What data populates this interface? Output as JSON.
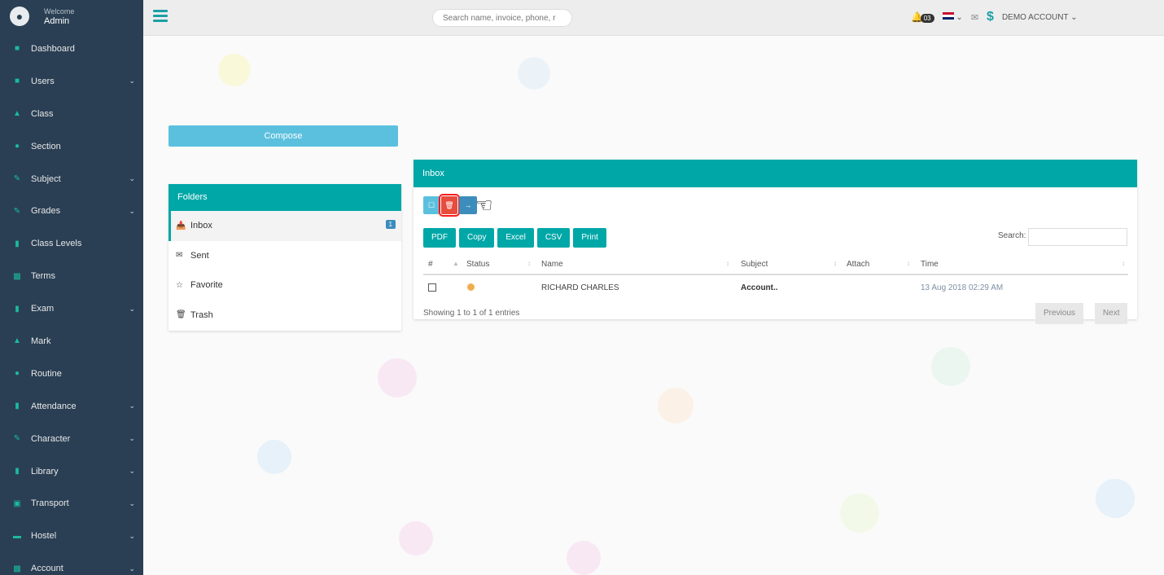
{
  "sidebar": {
    "welcome": "Welcome",
    "user": "Admin",
    "items": [
      {
        "label": "Dashboard",
        "icon": "home-icon",
        "chevron": false
      },
      {
        "label": "Users",
        "icon": "users-icon",
        "chevron": true
      },
      {
        "label": "Class",
        "icon": "class-icon",
        "chevron": false
      },
      {
        "label": "Section",
        "icon": "section-icon",
        "chevron": false
      },
      {
        "label": "Subject",
        "icon": "subject-icon",
        "chevron": true
      },
      {
        "label": "Grades",
        "icon": "grades-icon",
        "chevron": true
      },
      {
        "label": "Class Levels",
        "icon": "levels-icon",
        "chevron": false
      },
      {
        "label": "Terms",
        "icon": "terms-icon",
        "chevron": false
      },
      {
        "label": "Exam",
        "icon": "exam-icon",
        "chevron": true
      },
      {
        "label": "Mark",
        "icon": "mark-icon",
        "chevron": false
      },
      {
        "label": "Routine",
        "icon": "routine-icon",
        "chevron": false
      },
      {
        "label": "Attendance",
        "icon": "attendance-icon",
        "chevron": true
      },
      {
        "label": "Character",
        "icon": "character-icon",
        "chevron": true
      },
      {
        "label": "Library",
        "icon": "library-icon",
        "chevron": true
      },
      {
        "label": "Transport",
        "icon": "transport-icon",
        "chevron": true
      },
      {
        "label": "Hostel",
        "icon": "hostel-icon",
        "chevron": true
      },
      {
        "label": "Account",
        "icon": "account-icon",
        "chevron": true
      }
    ]
  },
  "topbar": {
    "search_placeholder": "Search name, invoice, phone, r",
    "notification_count": "03",
    "account_label": "DEMO ACCOUNT"
  },
  "mail": {
    "compose_label": "Compose",
    "folders_title": "Folders",
    "folders": [
      {
        "label": "Inbox",
        "icon": "inbox-icon",
        "count": "1"
      },
      {
        "label": "Sent",
        "icon": "envelope-icon",
        "count": ""
      },
      {
        "label": "Favorite",
        "icon": "star-icon",
        "count": ""
      },
      {
        "label": "Trash",
        "icon": "trash-icon",
        "count": ""
      }
    ],
    "inbox_title": "Inbox",
    "export_buttons": [
      "PDF",
      "Copy",
      "Excel",
      "CSV",
      "Print"
    ],
    "search_label": "Search:",
    "columns": [
      "#",
      "Status",
      "Name",
      "Subject",
      "Attach",
      "Time"
    ],
    "rows": [
      {
        "name": "RICHARD CHARLES",
        "subject": "Account..",
        "attach": "",
        "time": "13 Aug 2018 02:29 AM"
      }
    ],
    "showing": "Showing 1 to 1 of 1 entries",
    "previous": "Previous",
    "next": "Next"
  }
}
